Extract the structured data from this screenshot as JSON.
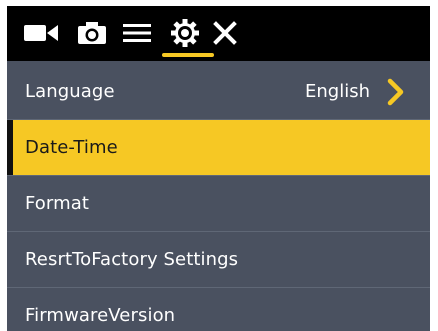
{
  "toolbar": {
    "icons": [
      "video-camera-icon",
      "photo-camera-icon",
      "list-menu-icon",
      "settings-gear-icon",
      "close-icon"
    ],
    "active_tab": "settings-gear-icon",
    "accent_color": "#f6c824"
  },
  "menu": {
    "items": [
      {
        "label": "Language",
        "value": "English",
        "has_chevron": true
      },
      {
        "label": "Date-Time",
        "selected": true
      },
      {
        "label": "Format"
      },
      {
        "label": "ResrtToFactory Settings"
      },
      {
        "label": "FirmwareVersion"
      }
    ]
  },
  "colors": {
    "background": "#4a5160",
    "topbar": "#000000",
    "highlight": "#f6c824",
    "text": "#ffffff"
  }
}
